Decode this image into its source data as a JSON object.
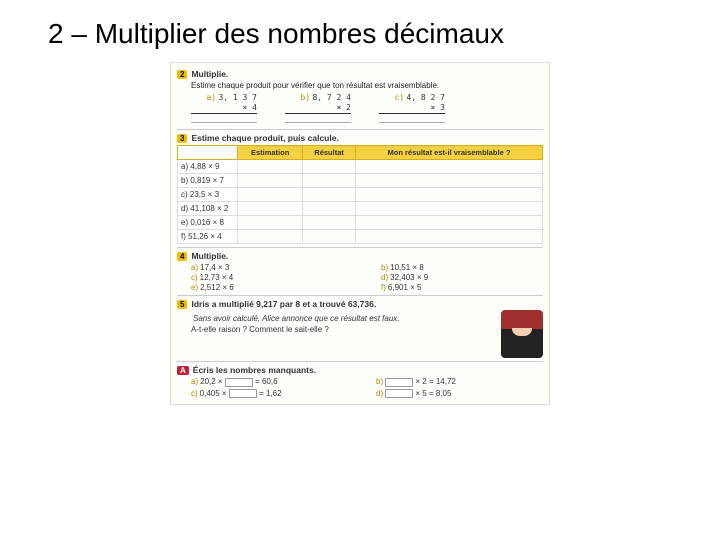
{
  "title": "2 – Multiplier des nombres décimaux",
  "ex2": {
    "num": "2",
    "title": "Multiplie.",
    "sub": "Estime chaque produit pour vérifier que ton résultat est vraisemblable.",
    "a": {
      "lbl": "a)",
      "top": "3, 1 3 7",
      "bot": "×       4"
    },
    "b": {
      "lbl": "b)",
      "top": "8, 7 2 4",
      "bot": "×       2"
    },
    "c": {
      "lbl": "c)",
      "top": "4, 8 2 7",
      "bot": "×       3"
    }
  },
  "ex3": {
    "num": "3",
    "title": "Estime chaque produit, puis calcule.",
    "h1": "Estimation",
    "h2": "Résultat",
    "h3": "Mon résultat est-il vraisemblable ?",
    "rows": {
      "a": "a) 4,88 × 9",
      "b": "b) 0,819 × 7",
      "c": "c) 23,5 × 3",
      "d": "d) 41,108 × 2",
      "e": "e) 0,016 × 8",
      "f": "f) 51,26 × 4"
    }
  },
  "ex4": {
    "num": "4",
    "title": "Multiplie.",
    "a": {
      "l": "a)",
      "t": "17,4 × 3"
    },
    "b": {
      "l": "b)",
      "t": "10,51 × 8"
    },
    "c": {
      "l": "c)",
      "t": "12,73 × 4"
    },
    "d": {
      "l": "d)",
      "t": "32,403 × 9"
    },
    "e": {
      "l": "e)",
      "t": "2,512 × 6"
    },
    "f": {
      "l": "f)",
      "t": "6,901 × 5"
    }
  },
  "ex5": {
    "num": "5",
    "line1": "Idris a multiplié 9,217 par 8 et a trouvé 63,736.",
    "line2": "Sans avoir calculé, Alice annonce que ce résultat est faux.",
    "line3": "A-t-elle raison ? Comment le sait-elle ?"
  },
  "exA": {
    "num": "A",
    "title": "Écris les nombres manquants.",
    "a": {
      "l": "a)",
      "left": "20,2 ×",
      "right": "= 60,6"
    },
    "b": {
      "l": "b)",
      "left": "",
      "right": "× 2 = 14,72"
    },
    "c": {
      "l": "c)",
      "left": "0,405 ×",
      "right": "= 1,62"
    },
    "d": {
      "l": "d)",
      "left": "",
      "right": "× 5 = 8,05"
    }
  }
}
